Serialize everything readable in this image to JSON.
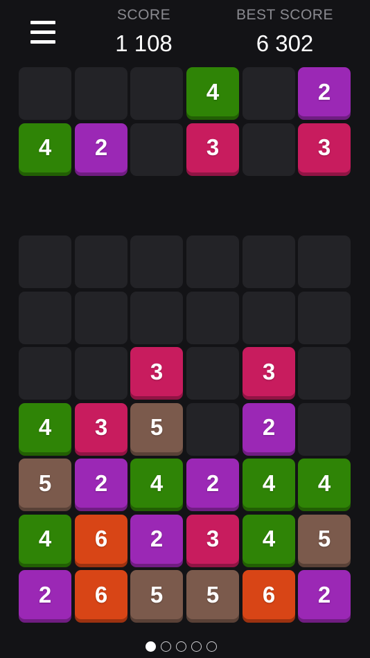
{
  "header": {
    "menu_icon": "hamburger-menu-icon",
    "score_label": "SCORE",
    "score_value": "1 108",
    "best_label": "BEST SCORE",
    "best_value": "6 302"
  },
  "colors": {
    "background": "#131316",
    "empty_cell": "#232327",
    "tile_2": "#9b28b5",
    "tile_3": "#c81c5e",
    "tile_4": "#2f8406",
    "tile_5": "#7b5a4c",
    "tile_6": "#d84516"
  },
  "incoming_rows": [
    [
      null,
      null,
      null,
      "4",
      null,
      "2"
    ],
    [
      "4",
      "2",
      null,
      "3",
      null,
      "3"
    ]
  ],
  "board_rows": [
    [
      null,
      null,
      null,
      null,
      null,
      null
    ],
    [
      null,
      null,
      null,
      null,
      null,
      null
    ],
    [
      null,
      null,
      "3",
      null,
      "3",
      null
    ],
    [
      "4",
      "3",
      "5",
      null,
      "2",
      null
    ],
    [
      "5",
      "2",
      "4",
      "2",
      "4",
      "4"
    ],
    [
      "4",
      "6",
      "2",
      "3",
      "4",
      "5"
    ],
    [
      "2",
      "6",
      "5",
      "5",
      "6",
      "2"
    ]
  ],
  "pagination": {
    "count": 5,
    "active_index": 0
  }
}
